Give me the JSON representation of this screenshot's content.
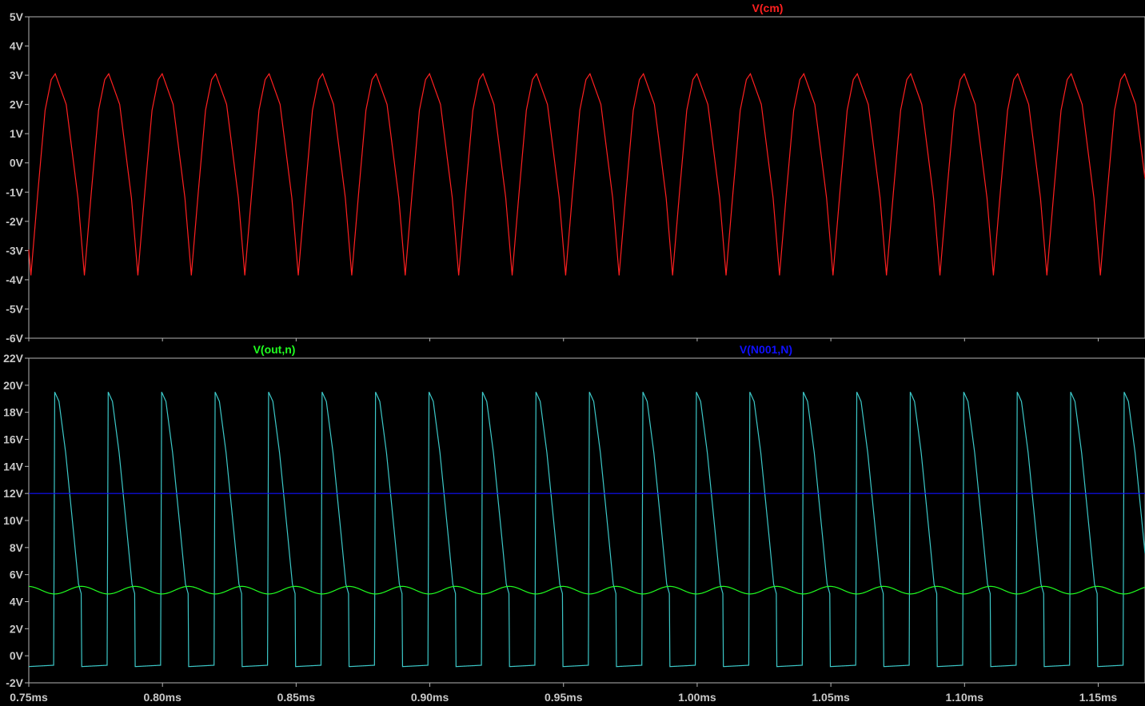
{
  "chart_data": [
    {
      "type": "line",
      "panel": "top",
      "x_unit": "ms",
      "xlim": [
        0.75,
        1.1675
      ],
      "x_ticks": [
        0.75,
        0.8,
        0.85,
        0.9,
        0.95,
        1.0,
        1.05,
        1.1,
        1.15
      ],
      "x_tick_labels": [
        "0.75ms",
        "0.80ms",
        "0.85ms",
        "0.90ms",
        "0.95ms",
        "1.00ms",
        "1.05ms",
        "1.10ms",
        "1.15ms"
      ],
      "ylim": [
        -6,
        5
      ],
      "y_ticks": [
        5,
        4,
        3,
        2,
        1,
        0,
        -1,
        -2,
        -3,
        -4,
        -5,
        -6
      ],
      "y_tick_labels": [
        "5V",
        "4V",
        "3V",
        "2V",
        "1V",
        "0V",
        "-1V",
        "-2V",
        "-3V",
        "-4V",
        "-5V",
        "-6V"
      ],
      "grid": false,
      "series": [
        {
          "name": "V(cm)",
          "color": "#ff2020",
          "waveform": "periodic",
          "period_ms": 0.02,
          "phase_ms": 0.7599,
          "points": [
            [
              0.0,
              3.05
            ],
            [
              0.0041,
              2.0
            ],
            [
              0.0085,
              -1.2
            ],
            [
              0.0109,
              -3.85
            ],
            [
              0.0135,
              -1.0
            ],
            [
              0.0162,
              1.8
            ],
            [
              0.0185,
              2.85
            ],
            [
              0.02,
              3.05
            ]
          ]
        }
      ]
    },
    {
      "type": "line",
      "panel": "bottom",
      "x_unit": "ms",
      "xlim": [
        0.75,
        1.1675
      ],
      "x_ticks": [
        0.75,
        0.8,
        0.85,
        0.9,
        0.95,
        1.0,
        1.05,
        1.1,
        1.15
      ],
      "x_tick_labels": [
        "0.75ms",
        "0.80ms",
        "0.85ms",
        "0.90ms",
        "0.95ms",
        "1.00ms",
        "1.05ms",
        "1.10ms",
        "1.15ms"
      ],
      "ylim": [
        -2,
        22
      ],
      "y_ticks": [
        22,
        20,
        18,
        16,
        14,
        12,
        10,
        8,
        6,
        4,
        2,
        0,
        -2
      ],
      "y_tick_labels": [
        "22V",
        "20V",
        "18V",
        "16V",
        "14V",
        "12V",
        "10V",
        "8V",
        "6V",
        "4V",
        "2V",
        "0V",
        "-2V"
      ],
      "grid": false,
      "series": [
        {
          "name": "",
          "color": "#3cc8c8",
          "waveform": "periodic",
          "period_ms": 0.02,
          "phase_ms": 0.7593,
          "points": [
            [
              0.0,
              -0.7
            ],
            [
              0.0004,
              19.5
            ],
            [
              0.002,
              18.8
            ],
            [
              0.0045,
              15.0
            ],
            [
              0.0075,
              9.0
            ],
            [
              0.0093,
              5.3
            ],
            [
              0.0103,
              4.6
            ],
            [
              0.0105,
              -0.8
            ],
            [
              0.02,
              -0.7
            ]
          ]
        },
        {
          "name": "V(out,n)",
          "color": "#20ff20",
          "waveform": "sine",
          "offset": 4.85,
          "amplitude": 0.28,
          "period_ms": 0.02,
          "phase_ms": 0.7647
        },
        {
          "name": "V(N001,N)",
          "color": "#1010ff",
          "waveform": "constant",
          "value": 12.0
        }
      ]
    }
  ]
}
